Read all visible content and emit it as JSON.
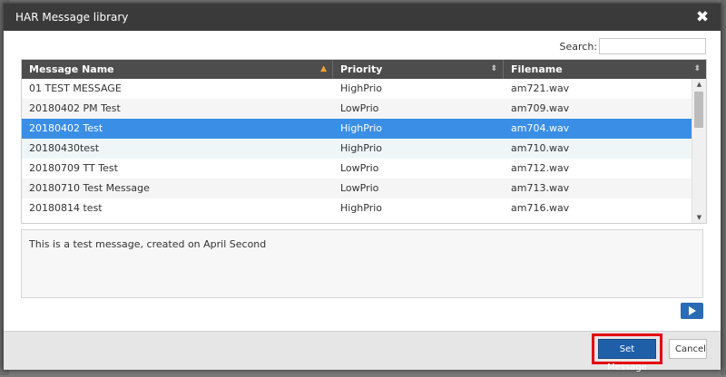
{
  "dialog": {
    "title": "HAR Message library",
    "close_icon": "close-icon"
  },
  "search": {
    "label": "Search:",
    "value": ""
  },
  "table": {
    "columns": [
      {
        "label": "Message Name",
        "sort": "ascending"
      },
      {
        "label": "Priority",
        "sort": "none"
      },
      {
        "label": "Filename",
        "sort": "none"
      }
    ],
    "rows": [
      {
        "name": "01 TEST MESSAGE",
        "priority": "HighPrio",
        "filename": "am721.wav",
        "state": "normal"
      },
      {
        "name": "20180402 PM Test",
        "priority": "LowPrio",
        "filename": "am709.wav",
        "state": "normal"
      },
      {
        "name": "20180402 Test",
        "priority": "HighPrio",
        "filename": "am704.wav",
        "state": "selected"
      },
      {
        "name": "20180430test",
        "priority": "HighPrio",
        "filename": "am710.wav",
        "state": "hover"
      },
      {
        "name": "20180709 TT Test",
        "priority": "LowPrio",
        "filename": "am712.wav",
        "state": "normal"
      },
      {
        "name": "20180710 Test Message",
        "priority": "LowPrio",
        "filename": "am713.wav",
        "state": "normal"
      },
      {
        "name": "20180814 test",
        "priority": "HighPrio",
        "filename": "am716.wav",
        "state": "normal"
      }
    ]
  },
  "message_text": "This is a test message, created on April Second",
  "play_icon": "play-icon",
  "footer": {
    "set_message_label": "Set Message",
    "cancel_label": "Cancel"
  },
  "colors": {
    "titlebar": "#3a3a3a",
    "header": "#4d4d4d",
    "selected_row": "#3a8ee6",
    "primary_button": "#1f5fa8",
    "highlight": "#e3000b",
    "sort_active": "#f0a030"
  }
}
